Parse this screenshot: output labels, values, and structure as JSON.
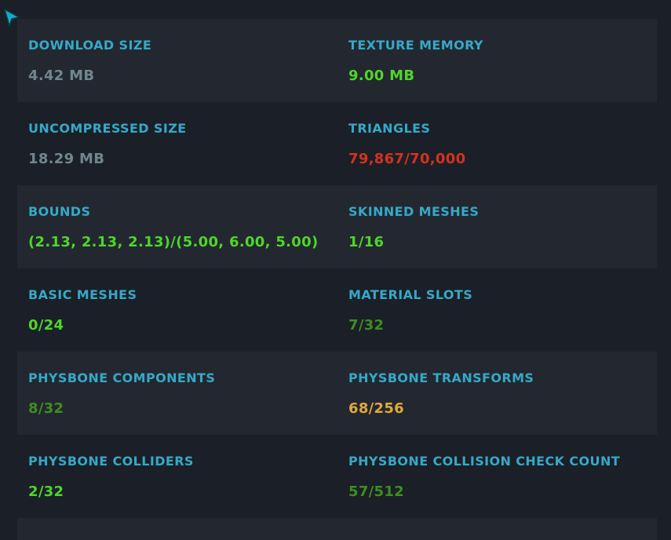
{
  "colors": {
    "background": "#1b1f27",
    "row_shaded": "#232730",
    "label": "#35a9c7",
    "neutral": "#71868f",
    "excellent": "#4ed62b",
    "good": "#3c8f1f",
    "medium": "#e0a93c",
    "poor": "#d4321e",
    "cursor": "#1aa9c8"
  },
  "cursor": {
    "icon": "cursor-arrow-icon"
  },
  "rows": [
    {
      "shaded": true,
      "cells": [
        {
          "id": "download-size",
          "label": "DOWNLOAD SIZE",
          "value": "4.42 MB",
          "status": "neutral"
        },
        {
          "id": "texture-memory",
          "label": "TEXTURE MEMORY",
          "value": "9.00 MB",
          "status": "excellent"
        }
      ]
    },
    {
      "shaded": false,
      "cells": [
        {
          "id": "uncompressed-size",
          "label": "UNCOMPRESSED SIZE",
          "value": "18.29 MB",
          "status": "neutral"
        },
        {
          "id": "triangles",
          "label": "TRIANGLES",
          "value": "79,867/70,000",
          "status": "poor"
        }
      ]
    },
    {
      "shaded": true,
      "cells": [
        {
          "id": "bounds",
          "label": "BOUNDS",
          "value": "(2.13, 2.13, 2.13)/(5.00, 6.00, 5.00)",
          "status": "excellent"
        },
        {
          "id": "skinned-meshes",
          "label": "SKINNED MESHES",
          "value": "1/16",
          "status": "excellent"
        }
      ]
    },
    {
      "shaded": false,
      "cells": [
        {
          "id": "basic-meshes",
          "label": "BASIC MESHES",
          "value": "0/24",
          "status": "excellent"
        },
        {
          "id": "material-slots",
          "label": "MATERIAL SLOTS",
          "value": "7/32",
          "status": "good"
        }
      ]
    },
    {
      "shaded": true,
      "cells": [
        {
          "id": "physbone-components",
          "label": "PHYSBONE COMPONENTS",
          "value": "8/32",
          "status": "good"
        },
        {
          "id": "physbone-transforms",
          "label": "PHYSBONE TRANSFORMS",
          "value": "68/256",
          "status": "medium"
        }
      ]
    },
    {
      "shaded": false,
      "cells": [
        {
          "id": "physbone-colliders",
          "label": "PHYSBONE COLLIDERS",
          "value": "2/32",
          "status": "excellent"
        },
        {
          "id": "physbone-collision-check-count",
          "label": "PHYSBONE COLLISION CHECK COUNT",
          "value": "57/512",
          "status": "good"
        }
      ]
    }
  ]
}
